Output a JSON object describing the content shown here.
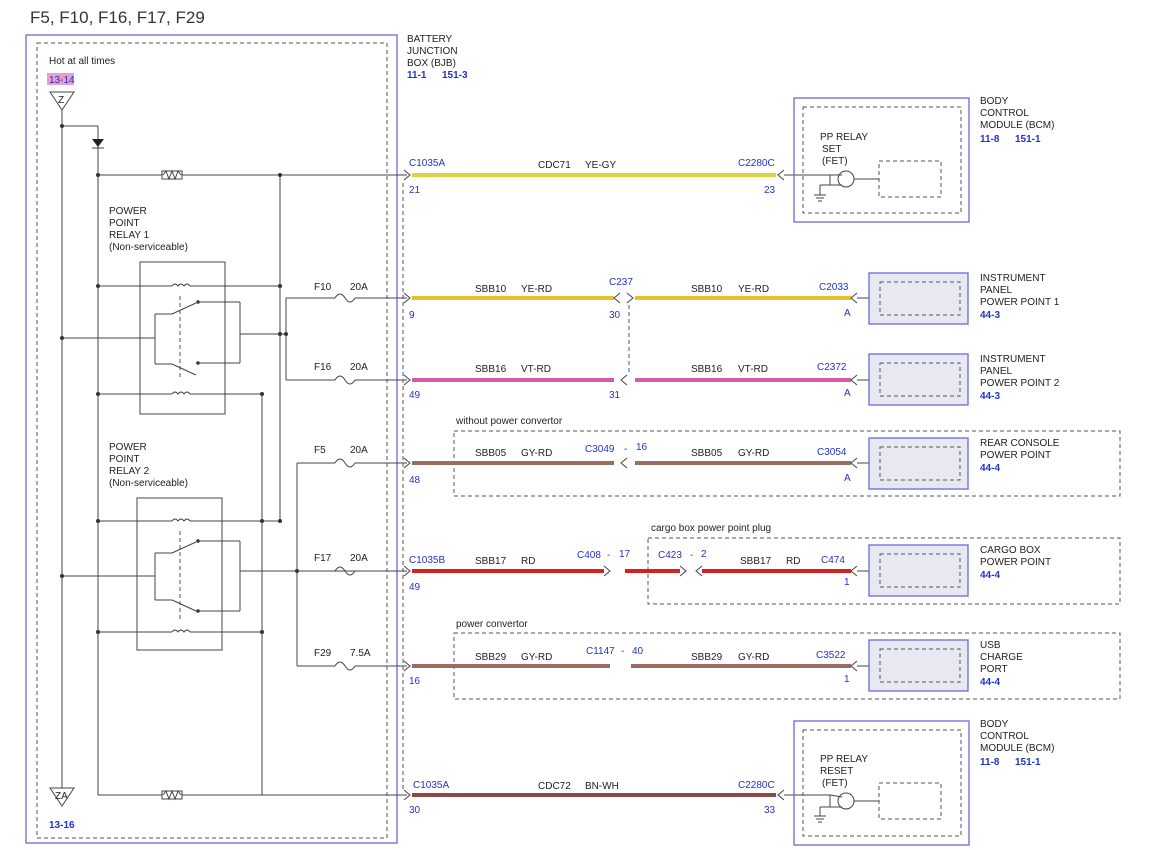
{
  "title": "F5, F10, F16, F17, F29",
  "hot_label": "Hot at all times",
  "hot_ref": "13-14",
  "ground_ref": "13-16",
  "bjb": {
    "l1": "BATTERY",
    "l2": "JUNCTION",
    "l3": "BOX (BJB)",
    "ref1": "11-1",
    "ref2": "151-3"
  },
  "relay1": {
    "l1": "POWER",
    "l2": "POINT",
    "l3": "RELAY 1",
    "l4": "(Non-serviceable)"
  },
  "relay2": {
    "l1": "POWER",
    "l2": "POINT",
    "l3": "RELAY 2",
    "l4": "(Non-serviceable)"
  },
  "fuses": [
    {
      "name": "F10",
      "amps": "20A"
    },
    {
      "name": "F16",
      "amps": "20A"
    },
    {
      "name": "F5",
      "amps": "20A"
    },
    {
      "name": "F17",
      "amps": "20A"
    },
    {
      "name": "F29",
      "amps": "7.5A"
    }
  ],
  "bcm_top": {
    "l1": "BODY",
    "l2": "CONTROL",
    "l3": "MODULE (BCM)",
    "ref1": "11-8",
    "ref2": "151-1",
    "inner1": "PP RELAY",
    "inner2": "SET",
    "inner3": "(FET)"
  },
  "bcm_bottom": {
    "l1": "BODY",
    "l2": "CONTROL",
    "l3": "MODULE (BCM)",
    "ref1": "11-8",
    "ref2": "151-1",
    "inner1": "PP RELAY",
    "inner2": "RESET",
    "inner3": "(FET)"
  },
  "circuits": [
    {
      "left_conn": "C1035A",
      "left_pin": "21",
      "circuit": "CDC71",
      "color": "YE-GY",
      "right_conn": "C2280C",
      "right_pin": "23",
      "wire_hex": "#dcd23c"
    },
    {
      "left_pin": "9",
      "circuit": "SBB10",
      "color": "YE-RD",
      "mid_conn": "C237",
      "mid_pin": "30",
      "circuit2": "SBB10",
      "color2": "YE-RD",
      "right_conn": "C2033",
      "right_pin": "A",
      "wire_hex": "#e8c02e"
    },
    {
      "left_pin": "49",
      "circuit": "SBB16",
      "color": "VT-RD",
      "mid_pin": "31",
      "circuit2": "SBB16",
      "color2": "VT-RD",
      "right_conn": "C2372",
      "right_pin": "A",
      "wire_hex": "#d65aaa"
    },
    {
      "left_pin": "48",
      "circuit": "SBB05",
      "color": "GY-RD",
      "mid_conn": "C3049",
      "mid_dash": "-",
      "mid_pin": "16",
      "circuit2": "SBB05",
      "color2": "GY-RD",
      "right_conn": "C3054",
      "right_pin": "A",
      "wire_hex": "#9a6c64"
    },
    {
      "left_conn": "C1035B",
      "left_pin": "49",
      "circuit": "SBB17",
      "color": "RD",
      "mid_conn": "C408",
      "mid_dash": "-",
      "mid_pin": "17",
      "mid2_conn": "C423",
      "mid2_dash": "-",
      "mid2_pin": "2",
      "circuit2": "SBB17",
      "color2": "RD",
      "right_conn": "C474",
      "right_pin": "1",
      "wire_hex": "#d42222"
    },
    {
      "left_pin": "16",
      "circuit": "SBB29",
      "color": "GY-RD",
      "mid_conn": "C1147",
      "mid_dash": "-",
      "mid_pin": "40",
      "circuit2": "SBB29",
      "color2": "GY-RD",
      "right_conn": "C3522",
      "right_pin": "1",
      "wire_hex": "#9a6c64"
    },
    {
      "left_conn": "C1035A",
      "left_pin": "30",
      "circuit": "CDC72",
      "color": "BN-WH",
      "right_conn": "C2280C",
      "right_pin": "33",
      "wire_hex": "#8a4a4a"
    }
  ],
  "groups": {
    "g1": "without power convertor",
    "g2": "cargo box power point plug",
    "g3": "power convertor"
  },
  "devices": [
    {
      "l1": "INSTRUMENT",
      "l2": "PANEL",
      "l3": "POWER POINT 1",
      "ref": "44-3"
    },
    {
      "l1": "INSTRUMENT",
      "l2": "PANEL",
      "l3": "POWER POINT 2",
      "ref": "44-3"
    },
    {
      "l1": "REAR CONSOLE",
      "l2": "POWER POINT",
      "ref": "44-4"
    },
    {
      "l1": "CARGO BOX",
      "l2": "POWER POINT",
      "ref": "44-4"
    },
    {
      "l1": "USB",
      "l2": "CHARGE",
      "l3": "PORT",
      "ref": "44-4"
    }
  ],
  "colors": {
    "panel_border": "#6a6ad8",
    "device_fill": "#e8e8f2",
    "ref_blue": "#2233cc",
    "hot_badge": "#e8a0c8"
  }
}
